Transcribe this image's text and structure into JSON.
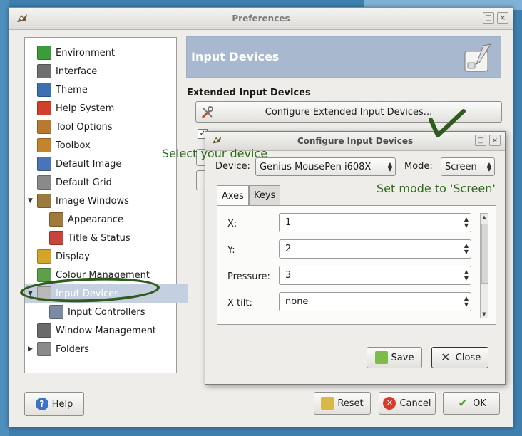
{
  "window": {
    "title": "Preferences"
  },
  "tree": {
    "items": [
      {
        "label": "Environment",
        "icon": "environment-icon",
        "color": "#3a9d3a"
      },
      {
        "label": "Interface",
        "icon": "interface-icon",
        "color": "#6f6f6f"
      },
      {
        "label": "Theme",
        "icon": "theme-icon",
        "color": "#3d6fb3"
      },
      {
        "label": "Help System",
        "icon": "help-system-icon",
        "color": "#d0402a"
      },
      {
        "label": "Tool Options",
        "icon": "tool-options-icon",
        "color": "#b77a2e"
      },
      {
        "label": "Toolbox",
        "icon": "toolbox-icon",
        "color": "#c4832d"
      },
      {
        "label": "Default Image",
        "icon": "default-image-icon",
        "color": "#4a74b5"
      },
      {
        "label": "Default Grid",
        "icon": "default-grid-icon",
        "color": "#8a8a8a"
      },
      {
        "label": "Image Windows",
        "icon": "image-windows-icon",
        "color": "#9b7b3c"
      },
      {
        "label": "Appearance",
        "icon": "appearance-icon",
        "color": "#a07a3a"
      },
      {
        "label": "Title & Status",
        "icon": "title-status-icon",
        "color": "#c7453a"
      },
      {
        "label": "Display",
        "icon": "display-icon",
        "color": "#d2a42a"
      },
      {
        "label": "Colour Management",
        "icon": "colour-management-icon",
        "color": "#5ca04a"
      },
      {
        "label": "Input Devices",
        "icon": "input-devices-icon",
        "color": "#b9b9b9"
      },
      {
        "label": "Input Controllers",
        "icon": "input-controllers-icon",
        "color": "#7a8aa0"
      },
      {
        "label": "Window Management",
        "icon": "window-management-icon",
        "color": "#6a6a6a"
      },
      {
        "label": "Folders",
        "icon": "folders-icon",
        "color": "#8a8a8a"
      }
    ],
    "selected": "Input Devices"
  },
  "header": {
    "title": "Input Devices"
  },
  "section": {
    "title": "Extended Input Devices"
  },
  "configure_button": {
    "label": "Configure Extended Input Devices..."
  },
  "buttons": {
    "help": "Help",
    "reset": "Reset",
    "cancel": "Cancel",
    "ok": "OK"
  },
  "dialog": {
    "title": "Configure Input Devices",
    "device_label": "Device:",
    "device_value": "Genius MousePen i608X",
    "mode_label": "Mode:",
    "mode_value": "Screen",
    "tabs": [
      "Axes",
      "Keys"
    ],
    "axes": [
      {
        "label": "X:",
        "value": "1"
      },
      {
        "label": "Y:",
        "value": "2"
      },
      {
        "label": "Pressure:",
        "value": "3"
      },
      {
        "label": "X tilt:",
        "value": "none"
      }
    ],
    "save_label": "Save",
    "close_label": "Close"
  },
  "annotations": {
    "select_device": "Select your device",
    "set_mode": "Set mode to 'Screen'",
    "color": "#2d6b1a"
  }
}
